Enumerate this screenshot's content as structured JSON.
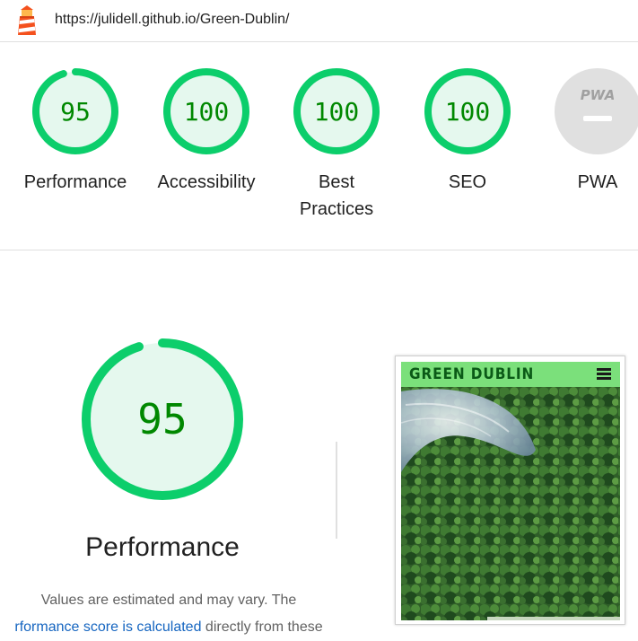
{
  "header": {
    "url": "https://julidell.github.io/Green-Dublin/"
  },
  "gauges": [
    {
      "label": "Performance",
      "score": "95",
      "value": 95
    },
    {
      "label": "Accessibility",
      "score": "100",
      "value": 100
    },
    {
      "label": "Best Practices",
      "score": "100",
      "value": 100
    },
    {
      "label": "SEO",
      "score": "100",
      "value": 100
    },
    {
      "label": "PWA",
      "badge": "PWA"
    }
  ],
  "performance": {
    "score": "95",
    "value": 95,
    "title": "Performance",
    "desc_line1": "Values are estimated and may vary. The",
    "desc_link": "rformance score is calculated",
    "desc_tail": " directly from these"
  },
  "screenshot": {
    "site_title": "GREEN DUBLIN"
  },
  "colors": {
    "pass": "#0cce6b",
    "pass_fill": "#e5f8ee",
    "pass_text": "#008800",
    "na": "#e0e0e0",
    "link": "#1565c0"
  }
}
